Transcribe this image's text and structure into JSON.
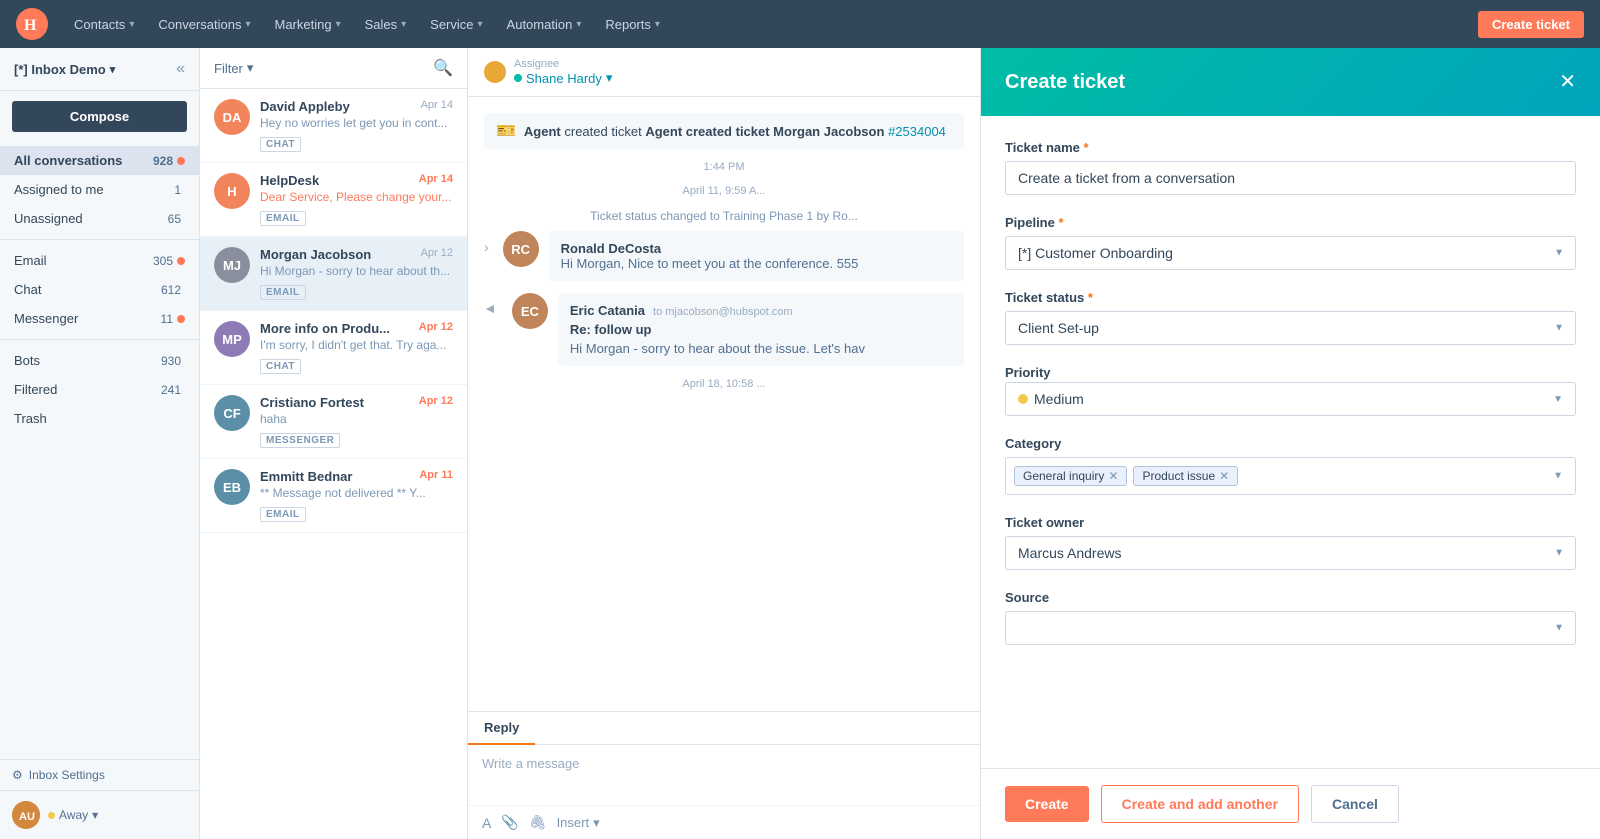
{
  "nav": {
    "logo_text": "H",
    "items": [
      {
        "label": "Contacts",
        "id": "contacts"
      },
      {
        "label": "Conversations",
        "id": "conversations"
      },
      {
        "label": "Marketing",
        "id": "marketing"
      },
      {
        "label": "Sales",
        "id": "sales"
      },
      {
        "label": "Service",
        "id": "service"
      },
      {
        "label": "Automation",
        "id": "automation"
      },
      {
        "label": "Reports",
        "id": "reports"
      }
    ],
    "create_ticket_label": "Create ticket"
  },
  "sidebar": {
    "inbox_title": "[*] Inbox Demo",
    "compose_label": "Compose",
    "nav_items": [
      {
        "label": "All conversations",
        "count": "928",
        "dot": true,
        "active": true
      },
      {
        "label": "Assigned to me",
        "count": "1",
        "dot": false
      },
      {
        "label": "Unassigned",
        "count": "65",
        "dot": false
      },
      {
        "label": "Email",
        "count": "305",
        "dot": true
      },
      {
        "label": "Chat",
        "count": "612",
        "dot": false
      },
      {
        "label": "Messenger",
        "count": "11",
        "dot": true
      },
      {
        "label": "Bots",
        "count": "930",
        "dot": false
      },
      {
        "label": "Filtered",
        "count": "241",
        "dot": false
      },
      {
        "label": "Trash",
        "count": "",
        "dot": false
      }
    ],
    "status_label": "Away",
    "settings_label": "Inbox Settings"
  },
  "conv_list": {
    "filter_label": "Filter",
    "items": [
      {
        "name": "David Appleby",
        "date": "Apr 14",
        "date_unread": false,
        "preview": "Hey no worries let get you in cont...",
        "badge": "CHAT",
        "avatar_bg": "#f2845b",
        "avatar_initials": "DA",
        "selected": false
      },
      {
        "name": "HelpDesk",
        "date": "Apr 14",
        "date_unread": true,
        "preview": "Dear Service, Please change your...",
        "badge": "EMAIL",
        "avatar_bg": "#f2845b",
        "avatar_initials": "H",
        "selected": false
      },
      {
        "name": "Morgan Jacobson",
        "date": "Apr 12",
        "date_unread": false,
        "preview": "Hi Morgan - sorry to hear about th...",
        "badge": "EMAIL",
        "avatar_bg": "#7c8a9e",
        "avatar_initials": "MJ",
        "selected": true
      },
      {
        "name": "More info on Produ...",
        "date": "Apr 12",
        "date_unread": true,
        "preview": "I'm sorry, I didn't get that. Try aga...",
        "badge": "CHAT",
        "avatar_bg": "#8e7ab5",
        "avatar_initials": "MP",
        "selected": false
      },
      {
        "name": "Cristiano Fortest",
        "date": "Apr 12",
        "date_unread": true,
        "preview": "haha",
        "badge": "MESSENGER",
        "avatar_bg": "#5b8fa8",
        "avatar_initials": "CF",
        "selected": false
      },
      {
        "name": "Emmitt Bednar",
        "date": "Apr 11",
        "date_unread": true,
        "preview": "** Message not delivered ** Y...",
        "badge": "EMAIL",
        "avatar_bg": "#5b8fa8",
        "avatar_initials": "EB",
        "selected": false
      }
    ]
  },
  "conv_view": {
    "assignee_label": "Assignee",
    "assignee_name": "Shane Hardy",
    "system_msg": "Agent created ticket Morgan Jacobson",
    "ticket_link": "#2534004",
    "time1": "1:44 PM",
    "time2": "April 11, 9:59 A...",
    "status_change": "Ticket status changed to Training Phase 1 by Ro...",
    "email1": {
      "sender": "Ronald DeCosta",
      "preview": "Hi Morgan, Nice to meet you at the conference. 555",
      "avatar_bg": "#c0855a",
      "avatar_initials": "RC"
    },
    "email2": {
      "sender": "Eric Catania",
      "to": "to mjacobson@hubspot.com",
      "subject": "Re: follow up",
      "body": "Hi Morgan - sorry to hear about the issue. Let's hav",
      "avatar_bg": "#c0855a",
      "avatar_initials": "EC"
    },
    "time3": "April 18, 10:58 ...",
    "reply_tab": "Reply",
    "reply_placeholder": "Write a message",
    "insert_label": "Insert"
  },
  "create_ticket": {
    "title": "Create ticket",
    "close_icon": "✕",
    "ticket_name_label": "Ticket name",
    "ticket_name_required": "*",
    "ticket_name_value": "Create a ticket from a conversation",
    "pipeline_label": "Pipeline",
    "pipeline_required": "*",
    "pipeline_value": "[*] Customer Onboarding",
    "ticket_status_label": "Ticket status",
    "ticket_status_required": "*",
    "ticket_status_value": "Client Set-up",
    "priority_label": "Priority",
    "priority_value": "Medium",
    "category_label": "Category",
    "category_tags": [
      "General inquiry",
      "Product issue"
    ],
    "ticket_owner_label": "Ticket owner",
    "ticket_owner_value": "Marcus Andrews",
    "source_label": "Source",
    "source_value": "",
    "btn_create": "Create",
    "btn_create_add": "Create and add another",
    "btn_cancel": "Cancel"
  }
}
